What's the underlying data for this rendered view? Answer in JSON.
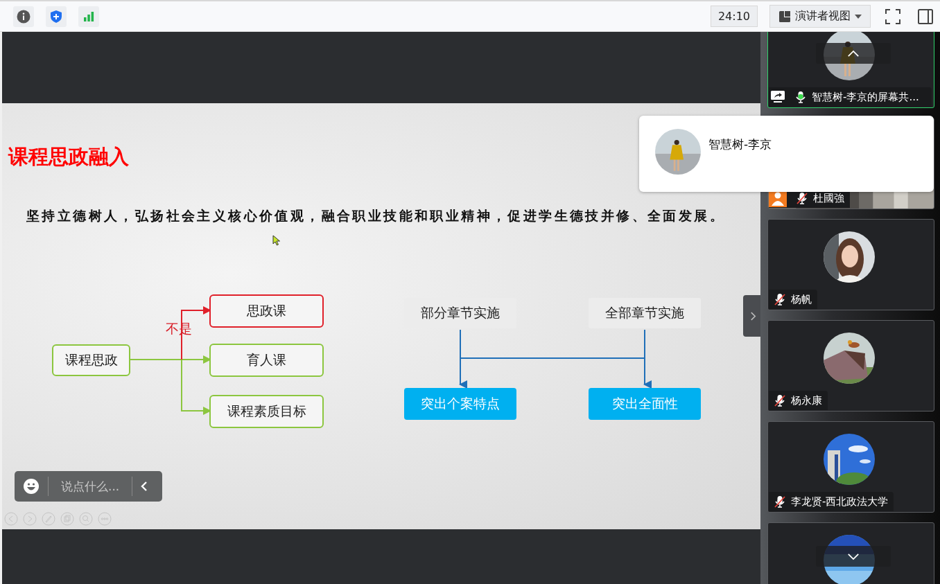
{
  "toolbar": {
    "timer": "24:10",
    "view_mode": "演讲者视图"
  },
  "slide": {
    "title": "课程思政融入",
    "subtitle": "坚持立德树人，弘扬社会主义核心价值观，融合职业技能和职业精神，促进学生德技并修、全面发展。",
    "left_diagram": {
      "root": "课程思政",
      "negation_label": "不是",
      "targets": [
        {
          "label": "思政课",
          "kind": "negated"
        },
        {
          "label": "育人课",
          "kind": "normal"
        },
        {
          "label": "课程素质目标",
          "kind": "normal"
        }
      ]
    },
    "right_diagram": {
      "sources": [
        "部分章节实施",
        "全部章节实施"
      ],
      "results": [
        "突出个案特点",
        "突出全面性"
      ]
    }
  },
  "chat": {
    "placeholder": "说点什么..."
  },
  "participants": [
    {
      "name": "智慧树-李京的屏幕共...",
      "muted": false,
      "sharing": true,
      "active": true,
      "host": false
    },
    {
      "name": "杜國強",
      "muted": true,
      "sharing": false,
      "active": false,
      "host": true
    },
    {
      "name": "杨帆",
      "muted": true,
      "sharing": false,
      "active": false,
      "host": false
    },
    {
      "name": "杨永康",
      "muted": true,
      "sharing": false,
      "active": false,
      "host": false
    },
    {
      "name": "李龙贤-西北政法大学",
      "muted": true,
      "sharing": false,
      "active": false,
      "host": false
    },
    {
      "active": false
    }
  ],
  "popup": {
    "name": "智慧树-李京"
  }
}
